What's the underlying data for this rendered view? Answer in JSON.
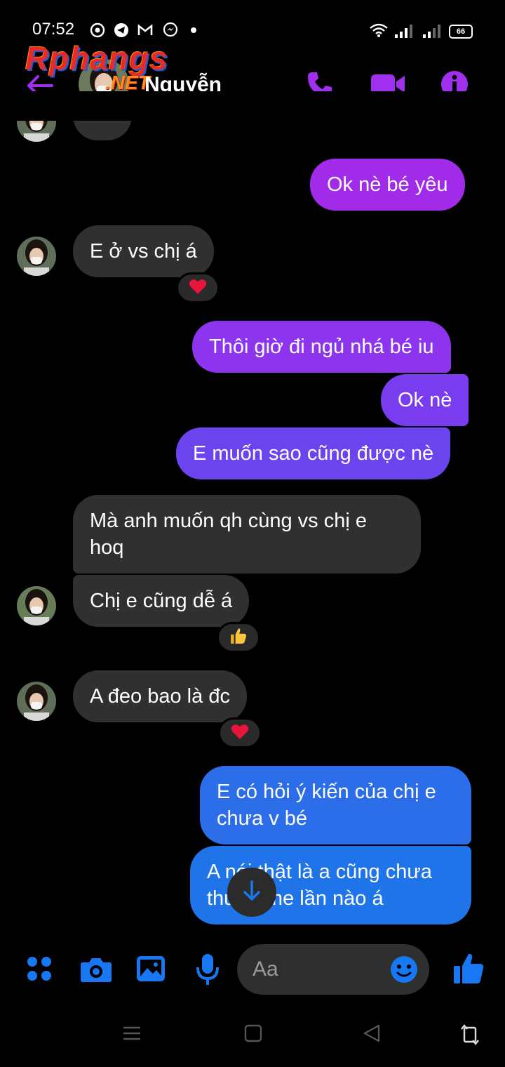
{
  "status_bar": {
    "time": "07:52",
    "battery": "66"
  },
  "watermark": {
    "brand": "Rphangs",
    "suffix": ".NET"
  },
  "header": {
    "name": "Nguyễn",
    "accent": "#9d2ff0"
  },
  "messages": [
    {
      "side": "in",
      "text": "E ở vs chị á",
      "reaction": "heart"
    },
    {
      "side": "out",
      "text": "Ok nè bé yêu"
    },
    {
      "side": "out",
      "text": "Thôi giờ đi ngủ nhá bé iu"
    },
    {
      "side": "out",
      "text": "Ok nè"
    },
    {
      "side": "out",
      "text": "E muốn sao cũng được nè"
    },
    {
      "side": "in",
      "text": "Mà anh muốn qh cùng vs chị e hoq"
    },
    {
      "side": "in",
      "text": "Chị e cũng dễ á",
      "reaction": "thumbs-up"
    },
    {
      "side": "in",
      "text": "A đeo bao là đc",
      "reaction": "heart"
    },
    {
      "side": "out",
      "text": "E có hỏi ý kiến của chị e chưa v bé"
    },
    {
      "side": "out",
      "text": "A nói thật là a cũng chưa thử home lần nào á"
    }
  ],
  "composer": {
    "placeholder": "Aa"
  },
  "colors": {
    "incoming": "#303030",
    "blue": "#1877f2",
    "purple_top": "#a22bea",
    "blue_bottom": "#1e74e8"
  }
}
